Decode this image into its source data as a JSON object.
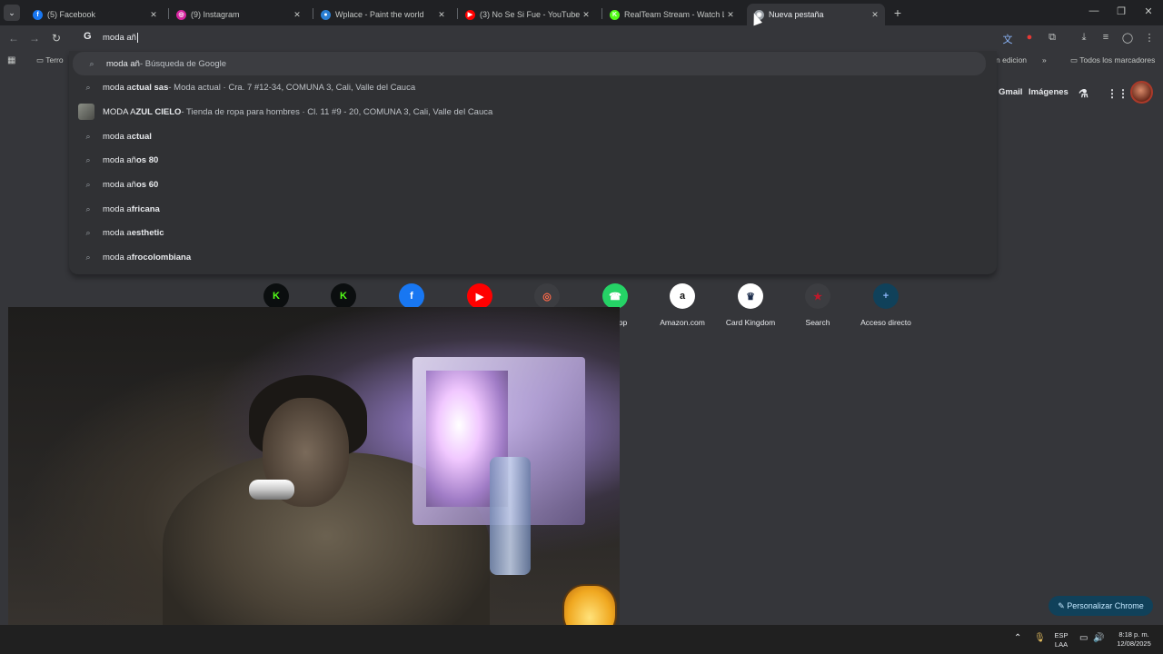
{
  "tabs": [
    {
      "title": "(5) Facebook",
      "icon": "facebook-icon",
      "color": "#1877f2",
      "glyph": "f"
    },
    {
      "title": "(9) Instagram",
      "icon": "instagram-icon",
      "color": "#d6249f",
      "glyph": "◎"
    },
    {
      "title": "Wplace - Paint the world",
      "icon": "globe-icon",
      "color": "#2a7fd4",
      "glyph": "●"
    },
    {
      "title": "(3) No Se Si Fue - YouTube",
      "icon": "youtube-icon",
      "color": "#ff0000",
      "glyph": "▶"
    },
    {
      "title": "RealTeam Stream - Watch Live",
      "icon": "kick-icon",
      "color": "#53fc18",
      "glyph": "K"
    },
    {
      "title": "Nueva pestaña",
      "icon": "chrome-icon",
      "color": "#9aa0a6",
      "glyph": "◉"
    }
  ],
  "omnibox": {
    "text": "moda añ"
  },
  "bookmarks": {
    "left": "Terro",
    "right": "n edicion",
    "all": "Todos los marcadores"
  },
  "suggestions": [
    {
      "type": "search",
      "prefix": "moda añ",
      "bold": "",
      "suffix": " - Búsqueda de Google"
    },
    {
      "type": "search",
      "prefix": "moda a",
      "bold": "ctual sas",
      "suffix": " - Moda actual · Cra. 7 #12-34, COMUNA 3, Cali, Valle del Cauca"
    },
    {
      "type": "place",
      "prefix": "MODA A",
      "bold": "ZUL CIELO",
      "suffix": " - Tienda de ropa para hombres · Cl. 11 #9 - 20, COMUNA 3, Cali, Valle del Cauca"
    },
    {
      "type": "search",
      "prefix": "moda a",
      "bold": "ctual",
      "suffix": ""
    },
    {
      "type": "search",
      "prefix": "moda añ",
      "bold": "os 80",
      "suffix": ""
    },
    {
      "type": "search",
      "prefix": "moda añ",
      "bold": "os 60",
      "suffix": ""
    },
    {
      "type": "search",
      "prefix": "moda a",
      "bold": "fricana",
      "suffix": ""
    },
    {
      "type": "search",
      "prefix": "moda a",
      "bold": "esthetic",
      "suffix": ""
    },
    {
      "type": "search",
      "prefix": "moda a",
      "bold": "frocolombiana",
      "suffix": ""
    }
  ],
  "google_links": {
    "gmail": "Gmail",
    "images": "Imágenes"
  },
  "shortcuts": [
    {
      "label": "",
      "glyph": "K",
      "color": "#53fc18",
      "bg": "#0b0e0f"
    },
    {
      "label": "",
      "glyph": "K",
      "color": "#53fc18",
      "bg": "#0b0e0f"
    },
    {
      "label": "",
      "glyph": "f",
      "color": "#ffffff",
      "bg": "#1877f2"
    },
    {
      "label": "",
      "glyph": "▶",
      "color": "#ffffff",
      "bg": "#ff0000"
    },
    {
      "label": "",
      "glyph": "◎",
      "color": "#ff6a4a",
      "bg": "#3c3d41"
    },
    {
      "label": "atsApp",
      "glyph": "☎",
      "color": "#ffffff",
      "bg": "#25d366"
    },
    {
      "label": "Amazon.com",
      "glyph": "a",
      "color": "#111111",
      "bg": "#ffffff"
    },
    {
      "label": "Card Kingdom",
      "glyph": "♛",
      "color": "#1a2b4a",
      "bg": "#ffffff"
    },
    {
      "label": "Search",
      "glyph": "★",
      "color": "#c0182a",
      "bg": "#3c3d41"
    },
    {
      "label": "Acceso directo",
      "glyph": "+",
      "color": "#8ab4f8",
      "bg": "#10415a"
    }
  ],
  "personalize": "Personalizar Chrome",
  "taskbar": {
    "lang1": "ESP",
    "lang2": "LAA",
    "time": "8:18 p. m.",
    "date": "12/08/2025"
  }
}
